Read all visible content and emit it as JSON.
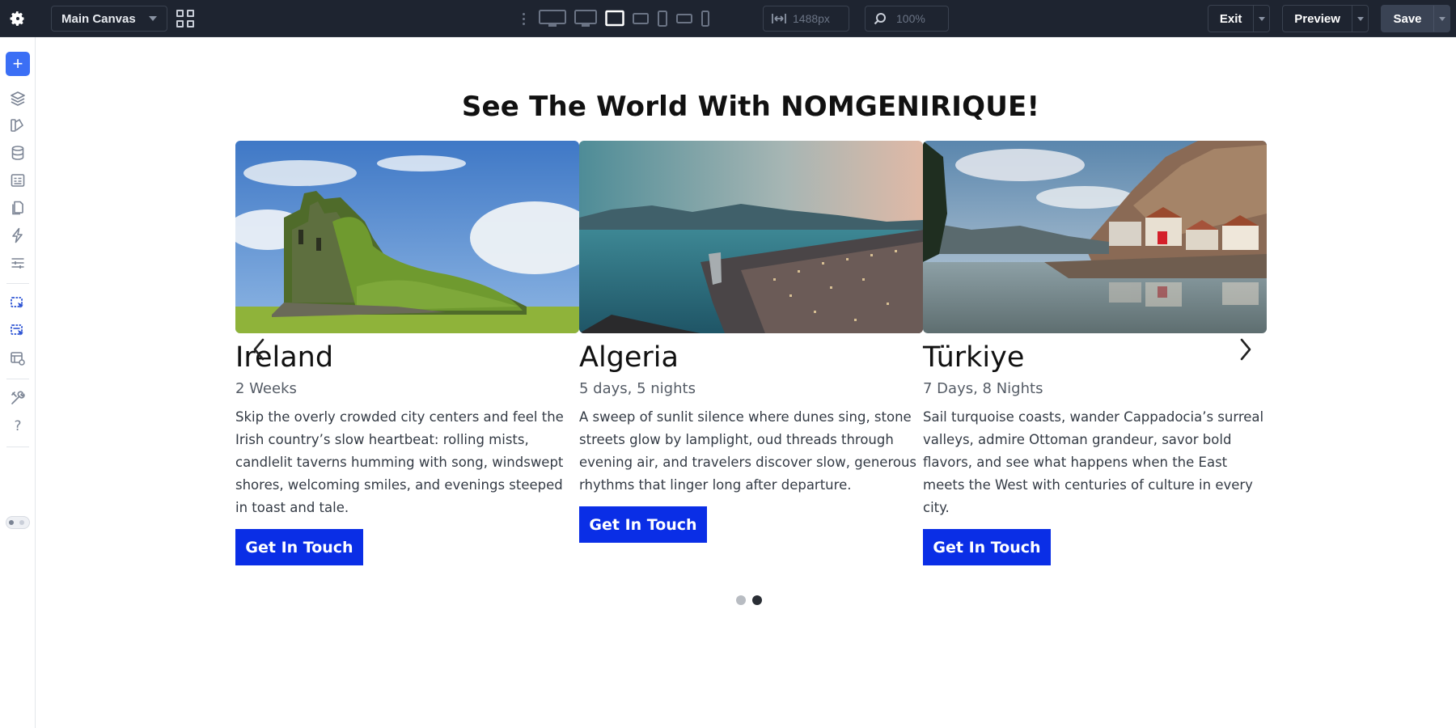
{
  "toolbar": {
    "canvas_select": "Main Canvas",
    "width_value": "1488px",
    "zoom_value": "100%",
    "exit_label": "Exit",
    "preview_label": "Preview",
    "save_label": "Save"
  },
  "colors": {
    "toolbar_bg": "#1e2430",
    "accent": "#3b6ff5",
    "cta": "#0a2ee6"
  },
  "page": {
    "heading": "See The World With NOMGENIRIQUE!",
    "cards": [
      {
        "title": "Ireland",
        "duration": "2 Weeks",
        "description": "Skip the overly crowded city centers and feel the Irish country’s slow heartbeat: rolling mists, candlelit taverns humming with song, windswept shores, welcoming smiles, and evenings steeped in toast and tale.",
        "cta": "Get In Touch"
      },
      {
        "title": "Algeria",
        "duration": "5 days, 5 nights",
        "description": "A sweep of sunlit silence where dunes sing, stone streets glow by lamplight, oud threads through evening air, and travelers discover slow, generous rhythms that linger long after departure.",
        "cta": "Get In Touch"
      },
      {
        "title": "Türkiye",
        "duration": "7 Days, 8 Nights",
        "description": "Sail turquoise coasts, wander Cappadocia’s surreal valleys, admire Ottoman grandeur, savor bold flavors, and see what happens when the East meets the West with centuries of culture in every city.",
        "cta": "Get In Touch"
      }
    ],
    "active_slide": 2,
    "slide_count": 2
  }
}
